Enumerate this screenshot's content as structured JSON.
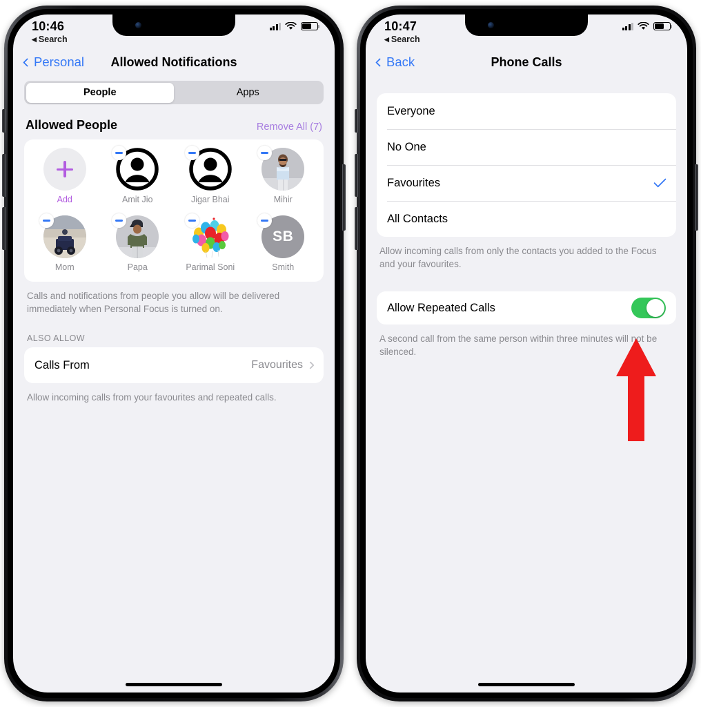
{
  "left_phone": {
    "status": {
      "time": "10:46",
      "back_label": "Search",
      "back_arrow": "◀",
      "signal_icon": "cellular-signal-icon",
      "wifi_icon": "wifi-icon",
      "battery_icon": "battery-icon"
    },
    "nav": {
      "back_label": "Personal",
      "title": "Allowed Notifications"
    },
    "segmented": {
      "options": [
        "People",
        "Apps"
      ],
      "selected": "People"
    },
    "section": {
      "title": "Allowed People",
      "action": "Remove All (7)"
    },
    "people": [
      {
        "name": "Add",
        "type": "add",
        "badge": false
      },
      {
        "name": "Amit Jio",
        "type": "silhouette",
        "badge": true
      },
      {
        "name": "Jigar Bhai",
        "type": "silhouette",
        "badge": true
      },
      {
        "name": "Mihir",
        "type": "photo-person-blue-shirt",
        "badge": true
      },
      {
        "name": "Mom",
        "type": "photo-beach-vehicle",
        "badge": true
      },
      {
        "name": "Papa",
        "type": "photo-person-cap",
        "badge": true
      },
      {
        "name": "Parimal Soni",
        "type": "photo-balloons",
        "badge": true
      },
      {
        "name": "Smith",
        "type": "initials",
        "initials": "SB",
        "badge": true
      }
    ],
    "people_footnote": "Calls and notifications from people you allow will be delivered immediately when Personal Focus is turned on.",
    "also_allow_label": "ALSO ALLOW",
    "calls_from": {
      "label": "Calls From",
      "value": "Favourites"
    },
    "calls_from_footnote": "Allow incoming calls from your favourites and repeated calls."
  },
  "right_phone": {
    "status": {
      "time": "10:47",
      "back_label": "Search",
      "back_arrow": "◀",
      "signal_icon": "cellular-signal-icon",
      "wifi_icon": "wifi-icon",
      "battery_icon": "battery-icon"
    },
    "nav": {
      "back_label": "Back",
      "title": "Phone Calls"
    },
    "options": [
      {
        "label": "Everyone",
        "selected": false
      },
      {
        "label": "No One",
        "selected": false
      },
      {
        "label": "Favourites",
        "selected": true
      },
      {
        "label": "All Contacts",
        "selected": false
      }
    ],
    "options_footnote": "Allow incoming calls from only the contacts you added to the Focus and your favourites.",
    "repeated": {
      "label": "Allow Repeated Calls",
      "enabled": true
    },
    "repeated_footnote": "A second call from the same person within three minutes will not be silenced."
  },
  "annotation": {
    "arrow_color": "#ee1c1c",
    "points_to": "allow-repeated-calls-toggle"
  },
  "colors": {
    "ios_blue": "#3478f6",
    "purple": "#b25ce0",
    "remove_all_purple": "#a77de0",
    "green_toggle": "#34c759",
    "screen_bg": "#f1f1f5",
    "card_bg": "#ffffff",
    "muted_text": "#8a8a8f"
  }
}
